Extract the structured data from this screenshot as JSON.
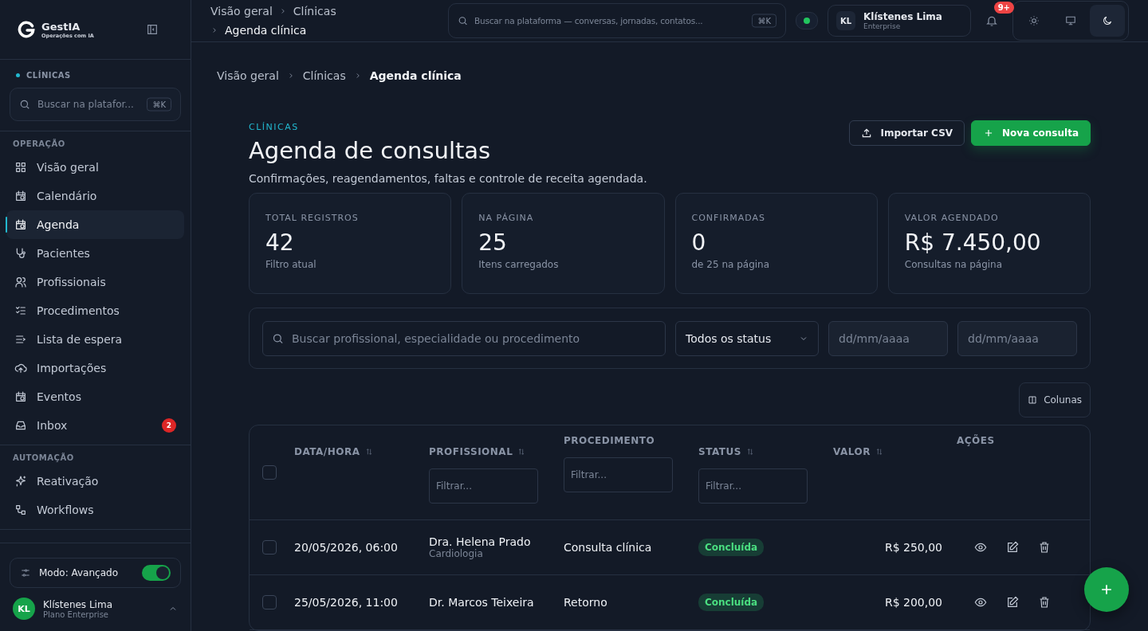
{
  "brand": {
    "name": "GestIA",
    "tagline": "Operações com IA"
  },
  "sidebar": {
    "context": "CLÍNICAS",
    "search": {
      "placeholder": "Buscar na platafor...",
      "shortcut": "⌘K"
    },
    "sections": [
      {
        "title": "OPERAÇÃO",
        "items": [
          {
            "label": "Visão geral",
            "selected": false
          },
          {
            "label": "Calendário",
            "selected": false
          },
          {
            "label": "Agenda",
            "selected": true
          },
          {
            "label": "Pacientes",
            "selected": false
          },
          {
            "label": "Profissionais",
            "selected": false
          },
          {
            "label": "Procedimentos",
            "selected": false
          },
          {
            "label": "Lista de espera",
            "selected": false
          },
          {
            "label": "Importações",
            "selected": false
          },
          {
            "label": "Eventos",
            "selected": false
          },
          {
            "label": "Inbox",
            "selected": false,
            "badge": "2"
          }
        ]
      },
      {
        "title": "AUTOMAÇÃO",
        "items": [
          {
            "label": "Reativação",
            "selected": false
          },
          {
            "label": "Workflows",
            "selected": false
          }
        ]
      }
    ],
    "mode": {
      "label": "Modo: Avançado",
      "on": true
    },
    "user": {
      "initials": "KL",
      "name": "Klístenes Lima",
      "plan": "Plano Enterprise"
    }
  },
  "topbar": {
    "breadcrumb": [
      "Visão geral",
      "Clínicas",
      "Agenda clínica"
    ],
    "search": {
      "placeholder": "Buscar na plataforma — conversas, jornadas, contatos...",
      "shortcut": "⌘K"
    },
    "user": {
      "initials": "KL",
      "name": "Klístenes Lima",
      "plan": "Enterprise"
    },
    "notifications": "9+",
    "theme_buttons": [
      {
        "selected": false
      },
      {
        "selected": false
      },
      {
        "selected": true
      }
    ]
  },
  "breadcrumb": [
    "Visão geral",
    "Clínicas",
    "Agenda clínica"
  ],
  "header": {
    "eyebrow": "CLÍNICAS",
    "title": "Agenda de consultas",
    "subtitle": "Confirmações, reagendamentos, faltas e controle de receita agendada.",
    "buttons": [
      {
        "label": "Importar CSV",
        "kind": "secondary"
      },
      {
        "label": "Nova consulta",
        "kind": "primary"
      }
    ]
  },
  "stats": [
    {
      "label": "TOTAL REGISTROS",
      "value": "42",
      "note": "Filtro atual"
    },
    {
      "label": "NA PÁGINA",
      "value": "25",
      "note": "Itens carregados"
    },
    {
      "label": "CONFIRMADAS",
      "value": "0",
      "note": "de 25 na página"
    },
    {
      "label": "VALOR AGENDADO",
      "value": "R$ 7.450,00",
      "note": "Consultas na página"
    }
  ],
  "filters": {
    "search": {
      "placeholder": "Buscar profissional, especialidade ou procedimento"
    },
    "status": "Todos os status",
    "date_from": {
      "placeholder": "dd/mm/aaaa"
    },
    "date_to": {
      "placeholder": "dd/mm/aaaa"
    }
  },
  "columns_button": "Colunas",
  "table": {
    "select_all": {
      "checked": false
    },
    "columns": [
      {
        "label": "DATA/HORA",
        "sortable": true
      },
      {
        "label": "PROFISSIONAL",
        "sortable": true,
        "filter": {
          "placeholder": "Filtrar..."
        }
      },
      {
        "label": "PROCEDIMENTO",
        "sortable": false,
        "filter": {
          "placeholder": "Filtrar..."
        }
      },
      {
        "label": "STATUS",
        "sortable": true,
        "filter": {
          "placeholder": "Filtrar..."
        }
      },
      {
        "label": "VALOR",
        "sortable": true
      },
      {
        "label": "AÇÕES",
        "sortable": false
      }
    ],
    "rows": [
      {
        "selected": false,
        "datetime": "20/05/2026, 06:00",
        "professional": "Dra. Helena Prado",
        "specialty": "Cardiologia",
        "procedure": "Consulta clínica",
        "status": "Concluída",
        "value": "R$ 250,00"
      },
      {
        "selected": false,
        "datetime": "25/05/2026, 11:00",
        "professional": "Dr. Marcos Teixeira",
        "procedure": "Retorno",
        "status": "Concluída",
        "value": "R$ 200,00"
      }
    ]
  }
}
